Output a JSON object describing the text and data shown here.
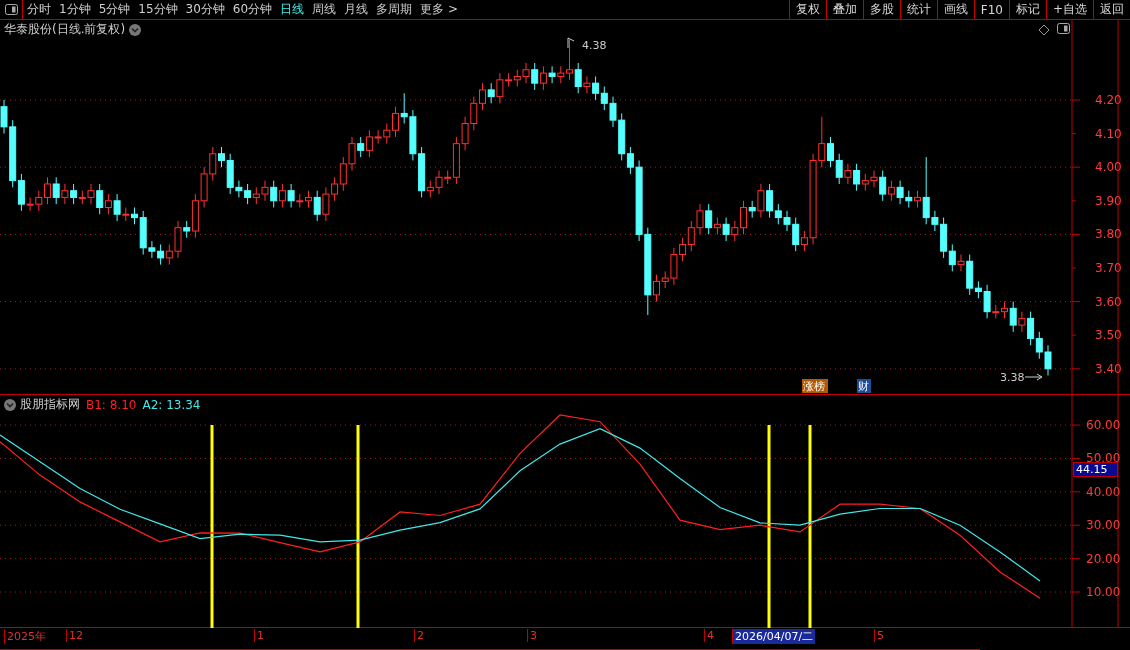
{
  "toolbar": {
    "periods": [
      {
        "label": "分时",
        "selected": false
      },
      {
        "label": "1分钟",
        "selected": false
      },
      {
        "label": "5分钟",
        "selected": false
      },
      {
        "label": "15分钟",
        "selected": false
      },
      {
        "label": "30分钟",
        "selected": false
      },
      {
        "label": "60分钟",
        "selected": false
      },
      {
        "label": "日线",
        "selected": true
      },
      {
        "label": "周线",
        "selected": false
      },
      {
        "label": "月线",
        "selected": false
      },
      {
        "label": "多周期",
        "selected": false
      },
      {
        "label": "更多 >",
        "selected": false
      }
    ],
    "actions": [
      "复权",
      "叠加",
      "多股",
      "统计",
      "画线",
      "F10",
      "标记",
      "+自选",
      "返回"
    ]
  },
  "price_panel": {
    "title": "华泰股份(日线.前复权)",
    "high_marker": "4.38",
    "low_marker": "3.38",
    "chart_data": {
      "type": "candlestick",
      "grid": true,
      "ylim": [
        3.4,
        4.438
      ],
      "yticks": [
        {
          "value": 4.2,
          "label": "4.20"
        },
        {
          "value": 4.1,
          "label": "4.10"
        },
        {
          "value": 4.0,
          "label": "4.00"
        },
        {
          "value": 3.9,
          "label": "3.90"
        },
        {
          "value": 3.8,
          "label": "3.80"
        },
        {
          "value": 3.7,
          "label": "3.70"
        },
        {
          "value": 3.6,
          "label": "3.60"
        },
        {
          "value": 3.5,
          "label": "3.50"
        },
        {
          "value": 3.4,
          "label": "3.40"
        }
      ],
      "ohlc": [
        [
          4.18,
          4.2,
          4.1,
          4.12
        ],
        [
          4.12,
          4.14,
          3.94,
          3.96
        ],
        [
          3.96,
          3.98,
          3.87,
          3.89
        ],
        [
          3.89,
          3.91,
          3.87,
          3.89
        ],
        [
          3.89,
          3.93,
          3.87,
          3.91
        ],
        [
          3.91,
          3.97,
          3.89,
          3.95
        ],
        [
          3.95,
          3.97,
          3.89,
          3.91
        ],
        [
          3.91,
          3.95,
          3.89,
          3.93
        ],
        [
          3.93,
          3.95,
          3.89,
          3.91
        ],
        [
          3.91,
          3.93,
          3.89,
          3.91
        ],
        [
          3.91,
          3.95,
          3.89,
          3.93
        ],
        [
          3.93,
          3.95,
          3.86,
          3.88
        ],
        [
          3.88,
          3.92,
          3.86,
          3.9
        ],
        [
          3.9,
          3.92,
          3.84,
          3.86
        ],
        [
          3.86,
          3.88,
          3.84,
          3.86
        ],
        [
          3.86,
          3.88,
          3.83,
          3.85
        ],
        [
          3.85,
          3.87,
          3.74,
          3.76
        ],
        [
          3.76,
          3.78,
          3.73,
          3.75
        ],
        [
          3.75,
          3.77,
          3.71,
          3.73
        ],
        [
          3.73,
          3.77,
          3.71,
          3.75
        ],
        [
          3.75,
          3.84,
          3.73,
          3.82
        ],
        [
          3.82,
          3.84,
          3.79,
          3.81
        ],
        [
          3.81,
          3.92,
          3.79,
          3.9
        ],
        [
          3.9,
          4.0,
          3.88,
          3.98
        ],
        [
          3.98,
          4.06,
          3.96,
          4.04
        ],
        [
          4.04,
          4.06,
          4.0,
          4.02
        ],
        [
          4.02,
          4.04,
          3.92,
          3.94
        ],
        [
          3.94,
          3.96,
          3.91,
          3.93
        ],
        [
          3.93,
          3.95,
          3.89,
          3.91
        ],
        [
          3.91,
          3.94,
          3.89,
          3.92
        ],
        [
          3.92,
          3.96,
          3.9,
          3.94
        ],
        [
          3.94,
          3.96,
          3.88,
          3.9
        ],
        [
          3.9,
          3.95,
          3.88,
          3.93
        ],
        [
          3.93,
          3.95,
          3.88,
          3.9
        ],
        [
          3.9,
          3.92,
          3.88,
          3.9
        ],
        [
          3.9,
          3.93,
          3.88,
          3.91
        ],
        [
          3.91,
          3.93,
          3.84,
          3.86
        ],
        [
          3.86,
          3.94,
          3.84,
          3.92
        ],
        [
          3.92,
          3.97,
          3.9,
          3.95
        ],
        [
          3.95,
          4.03,
          3.93,
          4.01
        ],
        [
          4.01,
          4.09,
          3.99,
          4.07
        ],
        [
          4.07,
          4.09,
          4.03,
          4.05
        ],
        [
          4.05,
          4.11,
          4.03,
          4.09
        ],
        [
          4.09,
          4.11,
          4.07,
          4.09
        ],
        [
          4.09,
          4.13,
          4.07,
          4.11
        ],
        [
          4.11,
          4.18,
          4.09,
          4.16
        ],
        [
          4.16,
          4.22,
          4.13,
          4.15
        ],
        [
          4.15,
          4.17,
          4.02,
          4.04
        ],
        [
          4.04,
          4.06,
          3.91,
          3.93
        ],
        [
          3.93,
          3.96,
          3.91,
          3.94
        ],
        [
          3.94,
          3.99,
          3.92,
          3.97
        ],
        [
          3.97,
          3.99,
          3.95,
          3.97
        ],
        [
          3.97,
          4.09,
          3.95,
          4.07
        ],
        [
          4.07,
          4.15,
          4.05,
          4.13
        ],
        [
          4.13,
          4.21,
          4.11,
          4.19
        ],
        [
          4.19,
          4.25,
          4.17,
          4.23
        ],
        [
          4.23,
          4.25,
          4.19,
          4.21
        ],
        [
          4.21,
          4.28,
          4.19,
          4.26
        ],
        [
          4.26,
          4.28,
          4.24,
          4.26
        ],
        [
          4.26,
          4.29,
          4.24,
          4.27
        ],
        [
          4.27,
          4.31,
          4.25,
          4.29
        ],
        [
          4.29,
          4.31,
          4.23,
          4.25
        ],
        [
          4.25,
          4.3,
          4.23,
          4.28
        ],
        [
          4.28,
          4.3,
          4.25,
          4.27
        ],
        [
          4.27,
          4.3,
          4.25,
          4.28
        ],
        [
          4.28,
          4.38,
          4.26,
          4.29
        ],
        [
          4.29,
          4.31,
          4.22,
          4.24
        ],
        [
          4.24,
          4.27,
          4.22,
          4.25
        ],
        [
          4.25,
          4.27,
          4.2,
          4.22
        ],
        [
          4.22,
          4.24,
          4.17,
          4.19
        ],
        [
          4.19,
          4.21,
          4.12,
          4.14
        ],
        [
          4.14,
          4.16,
          4.02,
          4.04
        ],
        [
          4.04,
          4.06,
          3.98,
          4.0
        ],
        [
          4.0,
          4.02,
          3.78,
          3.8
        ],
        [
          3.8,
          3.82,
          3.56,
          3.62
        ],
        [
          3.62,
          3.68,
          3.6,
          3.66
        ],
        [
          3.66,
          3.69,
          3.64,
          3.67
        ],
        [
          3.67,
          3.76,
          3.65,
          3.74
        ],
        [
          3.74,
          3.79,
          3.72,
          3.77
        ],
        [
          3.77,
          3.84,
          3.75,
          3.82
        ],
        [
          3.82,
          3.89,
          3.8,
          3.87
        ],
        [
          3.87,
          3.89,
          3.8,
          3.82
        ],
        [
          3.82,
          3.85,
          3.8,
          3.83
        ],
        [
          3.83,
          3.85,
          3.78,
          3.8
        ],
        [
          3.8,
          3.84,
          3.78,
          3.82
        ],
        [
          3.82,
          3.9,
          3.8,
          3.88
        ],
        [
          3.88,
          3.9,
          3.85,
          3.87
        ],
        [
          3.87,
          3.95,
          3.85,
          3.93
        ],
        [
          3.93,
          3.95,
          3.85,
          3.87
        ],
        [
          3.87,
          3.89,
          3.83,
          3.85
        ],
        [
          3.85,
          3.87,
          3.81,
          3.83
        ],
        [
          3.83,
          3.85,
          3.75,
          3.77
        ],
        [
          3.77,
          3.81,
          3.75,
          3.79
        ],
        [
          3.79,
          4.04,
          3.77,
          4.02
        ],
        [
          4.02,
          4.15,
          4.0,
          4.07
        ],
        [
          4.07,
          4.09,
          4.0,
          4.02
        ],
        [
          4.02,
          4.04,
          3.95,
          3.97
        ],
        [
          3.97,
          4.01,
          3.95,
          3.99
        ],
        [
          3.99,
          4.01,
          3.93,
          3.95
        ],
        [
          3.95,
          3.98,
          3.93,
          3.96
        ],
        [
          3.96,
          3.99,
          3.94,
          3.97
        ],
        [
          3.97,
          3.99,
          3.9,
          3.92
        ],
        [
          3.92,
          3.96,
          3.9,
          3.94
        ],
        [
          3.94,
          3.96,
          3.89,
          3.91
        ],
        [
          3.91,
          3.93,
          3.88,
          3.9
        ],
        [
          3.9,
          3.93,
          3.88,
          3.91
        ],
        [
          3.91,
          4.03,
          3.83,
          3.85
        ],
        [
          3.85,
          3.87,
          3.81,
          3.83
        ],
        [
          3.83,
          3.85,
          3.73,
          3.75
        ],
        [
          3.75,
          3.77,
          3.69,
          3.71
        ],
        [
          3.71,
          3.74,
          3.69,
          3.72
        ],
        [
          3.72,
          3.74,
          3.62,
          3.64
        ],
        [
          3.64,
          3.66,
          3.61,
          3.63
        ],
        [
          3.63,
          3.65,
          3.55,
          3.57
        ],
        [
          3.57,
          3.59,
          3.55,
          3.57
        ],
        [
          3.57,
          3.6,
          3.55,
          3.58
        ],
        [
          3.58,
          3.6,
          3.51,
          3.53
        ],
        [
          3.53,
          3.57,
          3.51,
          3.55
        ],
        [
          3.55,
          3.57,
          3.47,
          3.49
        ],
        [
          3.49,
          3.51,
          3.43,
          3.45
        ],
        [
          3.45,
          3.47,
          3.38,
          3.4
        ]
      ]
    },
    "tags": [
      {
        "label": "涨榜",
        "color": "#b35a00"
      },
      {
        "label": "财",
        "color": "#1d4e9a"
      }
    ]
  },
  "indicator_panel": {
    "name": "股朋指标网",
    "b1": "B1: 8.10",
    "a2": "A2: 13.34",
    "current_value": "44.15",
    "chart_data": {
      "type": "line",
      "grid": true,
      "ylim": [
        -0.78,
        69
      ],
      "yticks": [
        {
          "value": 60,
          "label": "60.00"
        },
        {
          "value": 50,
          "label": "50.00"
        },
        {
          "value": 40,
          "label": "40.00"
        },
        {
          "value": 30,
          "label": "30.00"
        },
        {
          "value": 20,
          "label": "20.00"
        },
        {
          "value": 10,
          "label": "10.00"
        }
      ],
      "series": [
        {
          "color": "#ff2020",
          "values": [
            55,
            45,
            37,
            31,
            25,
            27.7,
            27.6,
            24.8,
            22,
            25,
            34,
            32.9,
            36.3,
            51.5,
            63,
            61,
            48.3,
            31.5,
            28.7,
            30,
            28,
            36.3,
            36.3,
            35,
            27,
            16,
            8.1
          ]
        },
        {
          "color": "#40e8e8",
          "values": [
            57,
            49,
            41,
            34.8,
            30.4,
            26,
            27.3,
            27,
            25,
            25.5,
            28.5,
            30.8,
            34.9,
            46.3,
            54.3,
            58.9,
            53.1,
            44,
            35.3,
            30.7,
            30,
            33.3,
            35,
            35,
            30,
            22,
            13.3
          ]
        }
      ]
    }
  },
  "time_axis": [
    {
      "label": "2025年",
      "highlighted": false
    },
    {
      "label": "12",
      "highlighted": false
    },
    {
      "label": "1",
      "highlighted": false
    },
    {
      "label": "2",
      "highlighted": false
    },
    {
      "label": "3",
      "highlighted": false
    },
    {
      "label": "4",
      "highlighted": false
    },
    {
      "label": "2026/04/07/二",
      "highlighted": true
    },
    {
      "label": "5",
      "highlighted": false
    }
  ]
}
